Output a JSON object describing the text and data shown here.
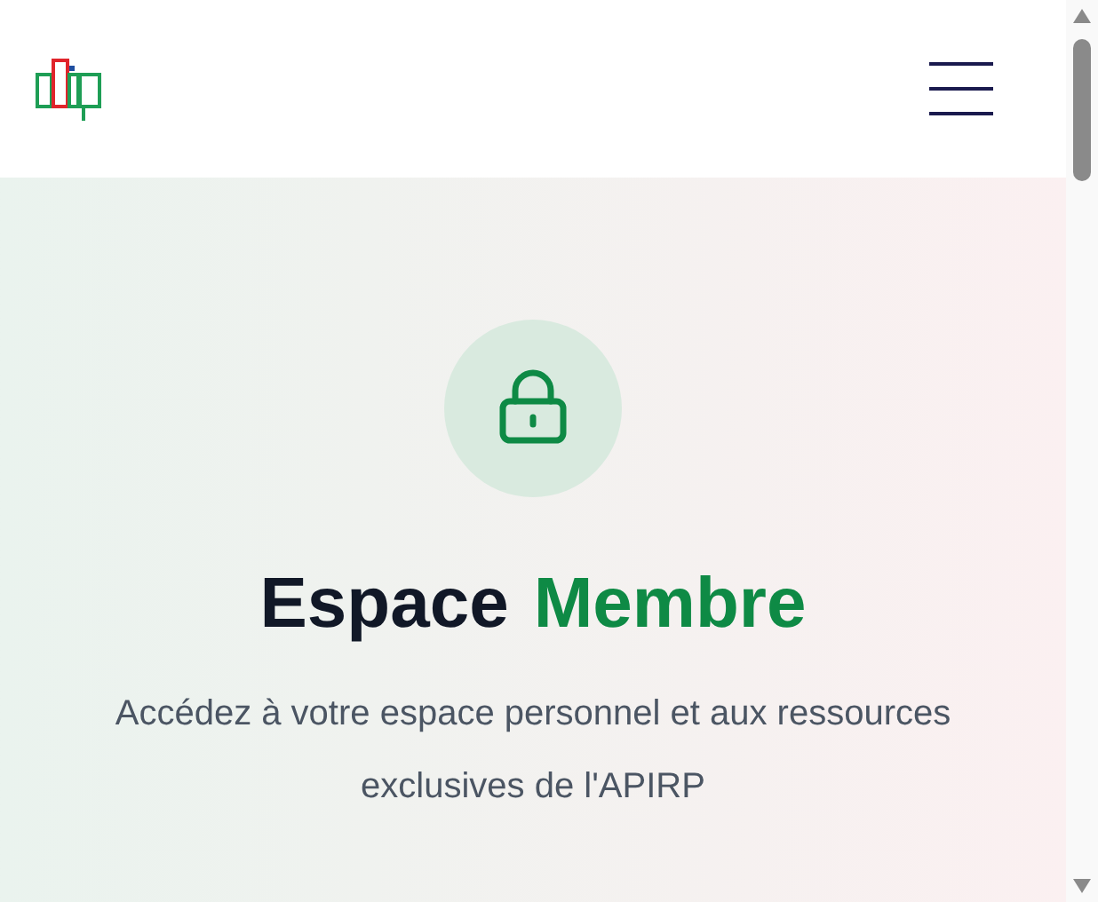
{
  "header": {
    "menu_open": false
  },
  "hero": {
    "title": [
      {
        "text": "Espace",
        "kind": "plain"
      },
      {
        "text": "Membre",
        "kind": "accent"
      }
    ],
    "description": "Accédez à votre espace personnel et aux ressources exclusives de l'APIRP"
  }
}
